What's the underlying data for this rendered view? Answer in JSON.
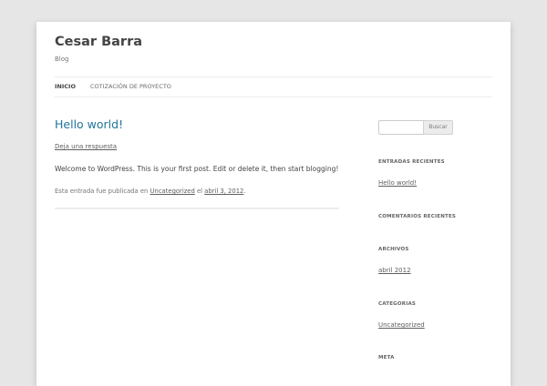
{
  "site": {
    "title": "Cesar Barra",
    "description": "Blog"
  },
  "nav": [
    {
      "label": "INICIO"
    },
    {
      "label": "COTIZACIÓN DE PROYECTO"
    }
  ],
  "post": {
    "title": "Hello world!",
    "reply_link": "Deja una respuesta",
    "body": "Welcome to WordPress. This is your first post. Edit or delete it, then start blogging!",
    "meta_prefix": "Esta entrada fue publicada en ",
    "category": "Uncategorized",
    "meta_mid": " el ",
    "date": "abril 3, 2012",
    "meta_suffix": "."
  },
  "sidebar": {
    "search_value": "",
    "search_button": "Buscar",
    "widgets": [
      {
        "title": "ENTRADAS RECIENTES",
        "link": "Hello world!"
      },
      {
        "title": "COMENTARIOS RECIENTES"
      },
      {
        "title": "ARCHIVOS",
        "link": "abril 2012"
      },
      {
        "title": "CATEGORIAS",
        "link": "Uncategorized"
      },
      {
        "title": "META"
      }
    ]
  },
  "colors": {
    "accent": "#21759b",
    "background": "#e6e6e6"
  }
}
